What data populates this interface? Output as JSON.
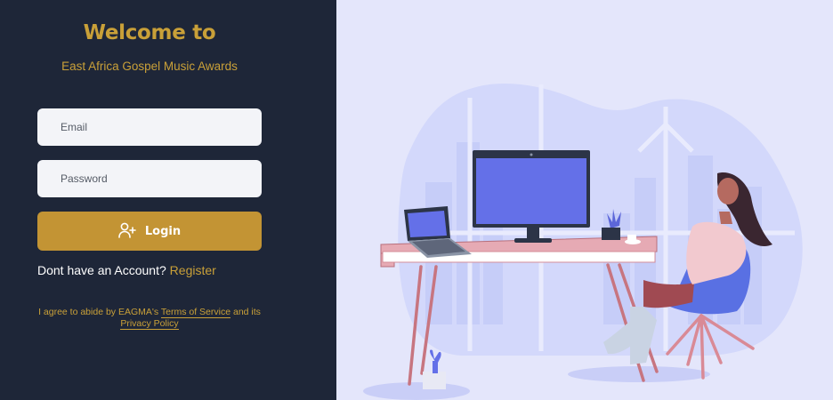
{
  "login": {
    "title": "Welcome to",
    "subtitle": "East Africa Gospel Music Awards",
    "email_placeholder": "Email",
    "password_placeholder": "Password",
    "login_label": "Login",
    "register_prompt": "Dont have an Account?",
    "register_link": "Register",
    "terms_prefix": "I agree to abide by EAGMA's",
    "terms_link": "Terms of Service",
    "terms_middle": "and its",
    "privacy_link": "Privacy Policy"
  },
  "icons": {
    "login_icon": "user-plus-icon"
  },
  "colors": {
    "panel_bg": "#1e2638",
    "accent": "#c39434",
    "illustration_bg": "#e4e6fb"
  }
}
